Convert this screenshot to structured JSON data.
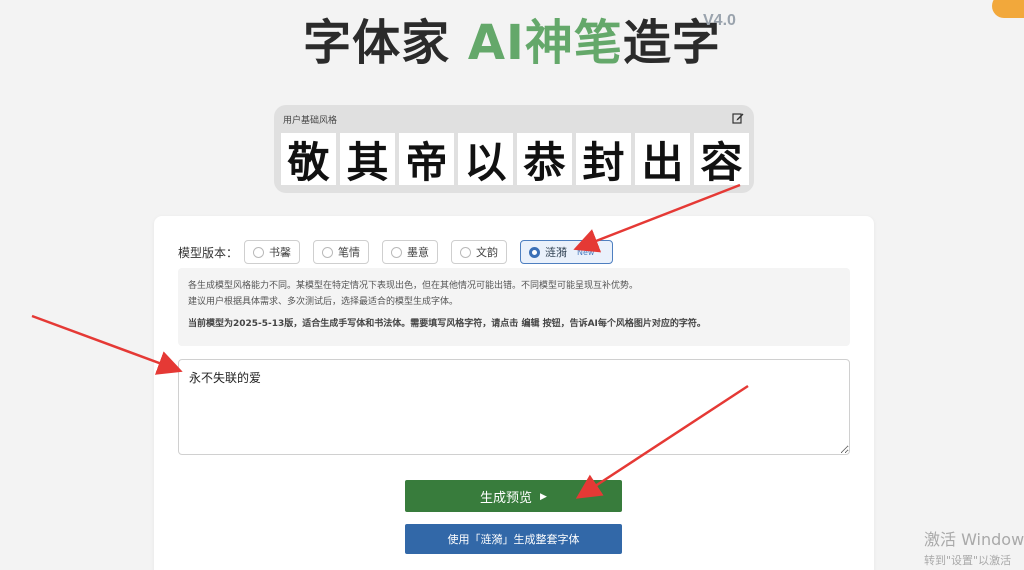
{
  "header": {
    "title_main": "字体家",
    "title_accent": "AI神笔",
    "title_tail": "造字",
    "version": "V4.0",
    "accent_color": "#64a86a"
  },
  "style_panel": {
    "label": "用户基础风格",
    "glyphs": [
      "敬",
      "其",
      "帝",
      "以",
      "恭",
      "封",
      "出",
      "容"
    ]
  },
  "model": {
    "label": "模型版本：",
    "options": [
      {
        "label": "书馨",
        "selected": false
      },
      {
        "label": "笔情",
        "selected": false
      },
      {
        "label": "墨意",
        "selected": false
      },
      {
        "label": "文韵",
        "selected": false
      },
      {
        "label": "涟漪",
        "selected": true,
        "tag": "New"
      }
    ]
  },
  "info": {
    "line1": "各生成模型风格能力不同。某模型在特定情况下表现出色，但在其他情况可能出错。不同模型可能呈现互补优势。",
    "line2": "建议用户根据具体需求、多次测试后，选择最适合的模型生成字体。",
    "line3": "当前模型为2025-5-13版，适合生成手写体和书法体。需要填写风格字符，请点击 编辑 按钮，告诉AI每个风格图片对应的字符。"
  },
  "input": {
    "value": "永不失联的爱"
  },
  "buttons": {
    "preview": "生成预览",
    "full_font": "使用「涟漪」生成整套字体"
  },
  "watermark": {
    "line1": "激活 Windows",
    "line2": "转到\"设置\"以激活"
  },
  "colors": {
    "primary_green": "#387c3c",
    "primary_blue": "#3268a8",
    "annotation_red": "#e53935"
  }
}
